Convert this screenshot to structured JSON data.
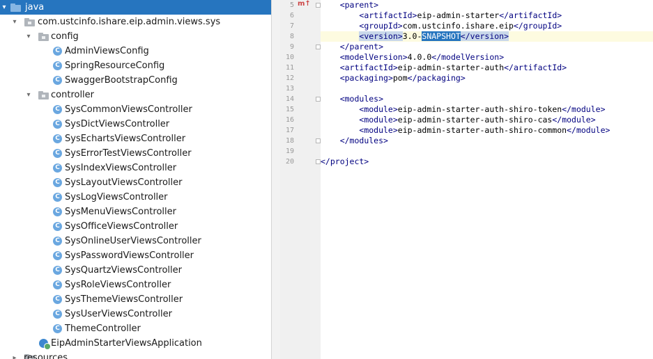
{
  "tree": {
    "rows": [
      {
        "label": "java",
        "selected": true,
        "expanded": true,
        "icon": "source-folder-icon"
      },
      {
        "label": "com.ustcinfo.ishare.eip.admin.views.sys",
        "expanded": true,
        "icon": "package-icon"
      },
      {
        "label": "config",
        "expanded": true,
        "icon": "package-icon"
      },
      {
        "label": "AdminViewsConfig",
        "icon": "class-icon",
        "badge": "C"
      },
      {
        "label": "SpringResourceConfig",
        "icon": "class-icon",
        "badge": "C"
      },
      {
        "label": "SwaggerBootstrapConfig",
        "icon": "class-icon",
        "badge": "C"
      },
      {
        "label": "controller",
        "expanded": true,
        "icon": "package-icon"
      },
      {
        "label": "SysCommonViewsController",
        "icon": "class-icon",
        "badge": "C"
      },
      {
        "label": "SysDictViewsController",
        "icon": "class-icon",
        "badge": "C"
      },
      {
        "label": "SysEchartsViewsController",
        "icon": "class-icon",
        "badge": "C"
      },
      {
        "label": "SysErrorTestViewsController",
        "icon": "class-icon",
        "badge": "C"
      },
      {
        "label": "SysIndexViewsController",
        "icon": "class-icon",
        "badge": "C"
      },
      {
        "label": "SysLayoutViewsController",
        "icon": "class-icon",
        "badge": "C"
      },
      {
        "label": "SysLogViewsController",
        "icon": "class-icon",
        "badge": "C"
      },
      {
        "label": "SysMenuViewsController",
        "icon": "class-icon",
        "badge": "C"
      },
      {
        "label": "SysOfficeViewsController",
        "icon": "class-icon",
        "badge": "C"
      },
      {
        "label": "SysOnlineUserViewsController",
        "icon": "class-icon",
        "badge": "C"
      },
      {
        "label": "SysPasswordViewsController",
        "icon": "class-icon",
        "badge": "C"
      },
      {
        "label": "SysQuartzViewsController",
        "icon": "class-icon",
        "badge": "C"
      },
      {
        "label": "SysRoleViewsController",
        "icon": "class-icon",
        "badge": "C"
      },
      {
        "label": "SysThemeViewsController",
        "icon": "class-icon",
        "badge": "C"
      },
      {
        "label": "SysUserViewsController",
        "icon": "class-icon",
        "badge": "C"
      },
      {
        "label": "ThemeController",
        "icon": "class-icon",
        "badge": "C"
      },
      {
        "label": "EipAdminStarterViewsApplication",
        "icon": "spring-boot-app-icon"
      },
      {
        "label": "resources",
        "icon": "resource-folder-icon"
      }
    ]
  },
  "editor": {
    "current_line": 8,
    "lines": [
      {
        "n": "5",
        "tokens": [
          {
            "t": "    "
          },
          {
            "t": "<parent>",
            "tag": true
          }
        ]
      },
      {
        "n": "6",
        "tokens": [
          {
            "t": "        "
          },
          {
            "t": "<artifactId>",
            "tag": true
          },
          {
            "t": "eip-admin-starter"
          },
          {
            "t": "</artifactId>",
            "tag": true
          }
        ]
      },
      {
        "n": "7",
        "tokens": [
          {
            "t": "        "
          },
          {
            "t": "<groupId>",
            "tag": true
          },
          {
            "t": "com.ustcinfo.ishare.eip"
          },
          {
            "t": "</groupId>",
            "tag": true
          }
        ]
      },
      {
        "n": "8",
        "tokens": [
          {
            "t": "        "
          },
          {
            "t": "<version>",
            "tag": true,
            "hl": true
          },
          {
            "t": "3.0-"
          },
          {
            "t": "SNAPSHOT",
            "snap": true
          },
          {
            "t": "</version>",
            "tag": true,
            "hl": true
          }
        ]
      },
      {
        "n": "9",
        "tokens": [
          {
            "t": "    "
          },
          {
            "t": "</parent>",
            "tag": true
          }
        ]
      },
      {
        "n": "10",
        "tokens": [
          {
            "t": "    "
          },
          {
            "t": "<modelVersion>",
            "tag": true
          },
          {
            "t": "4.0.0"
          },
          {
            "t": "</modelVersion>",
            "tag": true
          }
        ]
      },
      {
        "n": "11",
        "tokens": [
          {
            "t": "    "
          },
          {
            "t": "<artifactId>",
            "tag": true
          },
          {
            "t": "eip-admin-starter-auth"
          },
          {
            "t": "</artifactId>",
            "tag": true
          }
        ]
      },
      {
        "n": "12",
        "tokens": [
          {
            "t": "    "
          },
          {
            "t": "<packaging>",
            "tag": true
          },
          {
            "t": "pom"
          },
          {
            "t": "</packaging>",
            "tag": true
          }
        ]
      },
      {
        "n": "13",
        "tokens": []
      },
      {
        "n": "14",
        "tokens": [
          {
            "t": "    "
          },
          {
            "t": "<modules>",
            "tag": true
          }
        ]
      },
      {
        "n": "15",
        "tokens": [
          {
            "t": "        "
          },
          {
            "t": "<module>",
            "tag": true
          },
          {
            "t": "eip-admin-starter-auth-shiro-token"
          },
          {
            "t": "</module>",
            "tag": true
          }
        ]
      },
      {
        "n": "16",
        "tokens": [
          {
            "t": "        "
          },
          {
            "t": "<module>",
            "tag": true
          },
          {
            "t": "eip-admin-starter-auth-shiro-cas"
          },
          {
            "t": "</module>",
            "tag": true
          }
        ]
      },
      {
        "n": "17",
        "tokens": [
          {
            "t": "        "
          },
          {
            "t": "<module>",
            "tag": true
          },
          {
            "t": "eip-admin-starter-auth-shiro-common"
          },
          {
            "t": "</module>",
            "tag": true
          }
        ]
      },
      {
        "n": "18",
        "tokens": [
          {
            "t": "    "
          },
          {
            "t": "</modules>",
            "tag": true
          }
        ]
      },
      {
        "n": "19",
        "tokens": []
      },
      {
        "n": "20",
        "tokens": [
          {
            "t": ""
          },
          {
            "t": "</project>",
            "tag": true
          }
        ]
      }
    ]
  },
  "colors": {
    "selection": "#2675bf",
    "tag": "#000080",
    "current_line": "#fdfbe0",
    "gutter": "#f0f0f0",
    "tag_match": "#c9d8ea"
  }
}
